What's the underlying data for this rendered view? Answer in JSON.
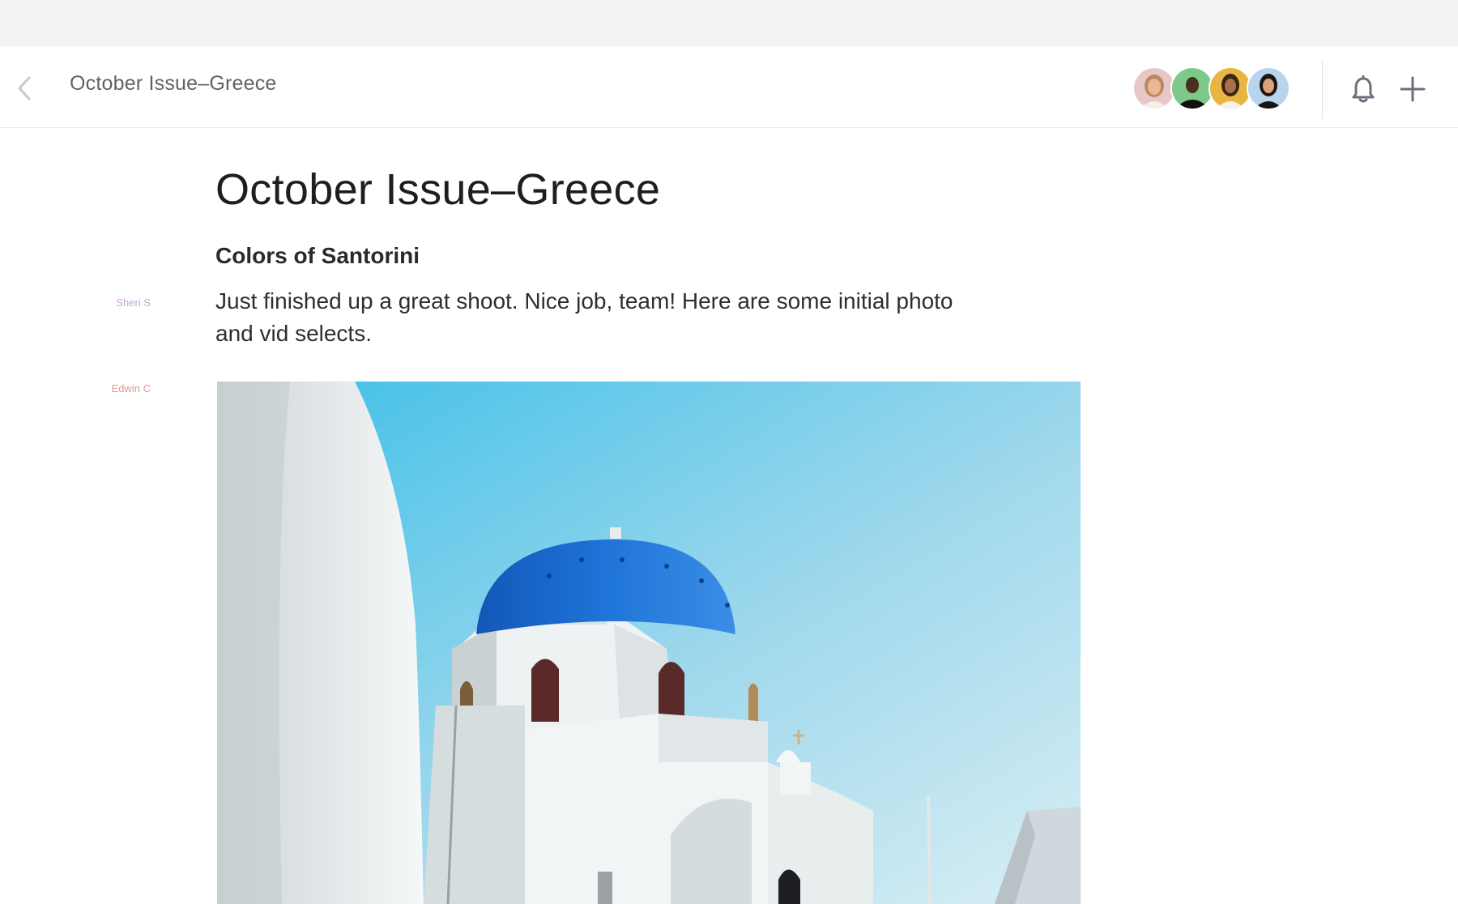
{
  "header": {
    "title": "October Issue–Greece",
    "back_icon": "chevron-left-icon",
    "notifications_icon": "bell-icon",
    "add_icon": "plus-icon",
    "collaborators": [
      {
        "avatar_bg": "#e7c8c6"
      },
      {
        "avatar_bg": "#7dc98a"
      },
      {
        "avatar_bg": "#e8b640"
      },
      {
        "avatar_bg": "#b8d4ee"
      }
    ]
  },
  "document": {
    "title": "October Issue–Greece",
    "section_heading": "Colors of Santorini",
    "paragraph": "Just finished up a great shoot. Nice job, team! Here are some initial photo and vid selects.",
    "authors": {
      "paragraph_author": "Sheri S",
      "image_author": "Edwin C"
    }
  },
  "colors": {
    "top_strip": "#f3f3f3",
    "dome_blue": "#1f6fd0",
    "sky": "#7ccdea",
    "author_sheri": "#c7a3d8",
    "author_edwin": "#e39595"
  }
}
